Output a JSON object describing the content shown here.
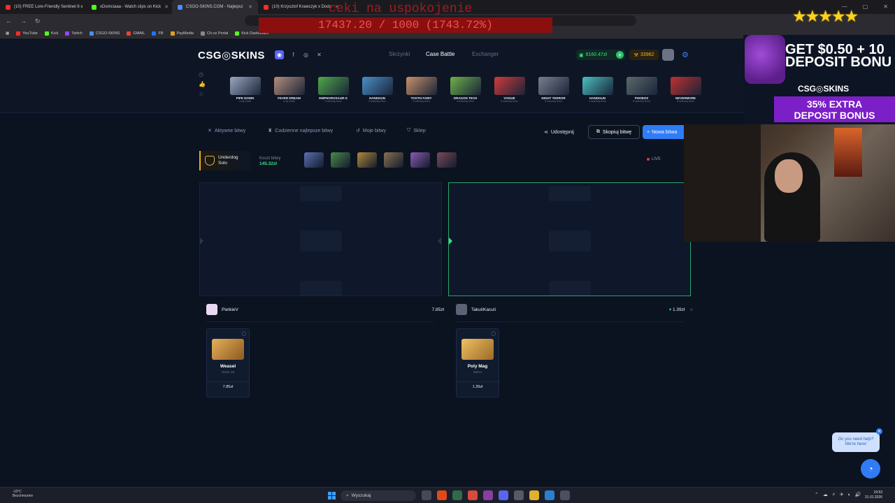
{
  "browser": {
    "tabs": [
      {
        "label": "(10) FREE Lore-Friendly Sentinel 6 x",
        "color": "#ff2a2a"
      },
      {
        "label": "xDomciaaa - Watch clips on Kick",
        "color": "#53fc18"
      },
      {
        "label": "CSGO-SKINS.COM - Najlepsz",
        "color": "#4b8cff"
      },
      {
        "label": "(10) Krzysztof Krawczyk x Doda",
        "color": "#ff2a2a"
      }
    ],
    "bookmarks": [
      {
        "label": "YouTube",
        "color": "#ff2a2a"
      },
      {
        "label": "Kick",
        "color": "#53fc18"
      },
      {
        "label": "Twitch",
        "color": "#9146ff"
      },
      {
        "label": "CSGO-SKINS",
        "color": "#4b8cff"
      },
      {
        "label": "GMAIL",
        "color": "#ea4335"
      },
      {
        "label": "FB",
        "color": "#1877f2"
      },
      {
        "label": "PayMedia",
        "color": "#e0a020"
      },
      {
        "label": "Ch.ce Portal",
        "color": "#888888"
      },
      {
        "label": "Kick Dashboard",
        "color": "#53fc18"
      }
    ]
  },
  "overlay": {
    "title": "ceki na uspokojenie",
    "counter": "17437.20 / 1000 (1743.72%)",
    "stars": "★★★★★"
  },
  "site": {
    "logo": "CSG◎SKINS",
    "nav": {
      "cases": "Skrzynki",
      "battle": "Case Battle",
      "exchanger": "Exchanger"
    },
    "balance": "8160.47zł",
    "gems": "33962"
  },
  "drops": [
    {
      "name": "PIPE DOWN",
      "sub": "w tej chwili",
      "color": "#9aa7bf"
    },
    {
      "name": "FEVER DREAM",
      "sub": "w tej chwili",
      "color": "#b58e7a"
    },
    {
      "name": "EMPHOROSAUR-S",
      "sub": "2 sekundy temu",
      "color": "#4fa84a"
    },
    {
      "name": "HANDGUN",
      "sub": "2 sekundy temu",
      "color": "#4b8fc8"
    },
    {
      "name": "TOOTH FAIRY",
      "sub": "3 sekundy temu",
      "color": "#c8906a"
    },
    {
      "name": "DRAGON TECH",
      "sub": "4 sekundy temu",
      "color": "#6fb04a"
    },
    {
      "name": "VOGUE",
      "sub": "4 sekundy temu",
      "color": "#d23a3a"
    },
    {
      "name": "NIGHT TERROR",
      "sub": "5 sekundy temu",
      "color": "#7a7f8c"
    },
    {
      "name": "HANDGUN",
      "sub": "5 sekundy temu",
      "color": "#4bbfc0"
    },
    {
      "name": "PHOBOS",
      "sub": "6 sekundy temu",
      "color": "#5b6a6c"
    },
    {
      "name": "NEVERMORE",
      "sub": "6 sekundy temu",
      "color": "#c03030"
    }
  ],
  "subnav": {
    "active": "Aktywne bitwy",
    "daily": "Codzienne najlepsze bitwy",
    "mine": "Moje bitwy",
    "shop": "Sklep",
    "share": "Udostępnij",
    "copy": "Skopiuj bitwę",
    "new": "Nowa bitwa"
  },
  "battle": {
    "mode_line1": "Underdog",
    "mode_line2": "Solo",
    "cost_label": "Koszt bitwy",
    "cost_value": "145.32zł",
    "live": "LIVE",
    "cases": [
      "#5a6fb0",
      "#4a8a4a",
      "#b08a3a",
      "#8a7050",
      "#8a5ab0",
      "#7a4a5a"
    ]
  },
  "players": [
    {
      "name": "PietkieV",
      "amount": "7.85zł",
      "avatar": "#e9d8f4",
      "item": {
        "name": "Weasel",
        "sub": "Glock-18",
        "price": "7.85zł",
        "color": "#c8903a"
      }
    },
    {
      "name": "TakuIiKacuIi",
      "amount": "1.39zł",
      "avatar": "#5b6474",
      "item": {
        "name": "Poly Mag",
        "sub": "M4A4",
        "price": "1.39zł",
        "color": "#d8a24a"
      }
    }
  ],
  "help": {
    "line1": "Do you need help?",
    "line2": "We're here!"
  },
  "ad": {
    "line1": "GET $0.50 + 10",
    "line2": "DEPOSIT BONU",
    "logo": "CSG◎SKINS",
    "bonus1": "35% EXTRA",
    "bonus2": "DEPOSIT BONUS"
  },
  "taskbar": {
    "weather_temp": "-10°C",
    "weather_desc": "Bezchmurnie",
    "search": "Wyszukaj",
    "time": "19:53",
    "date": "31.01.2026"
  }
}
